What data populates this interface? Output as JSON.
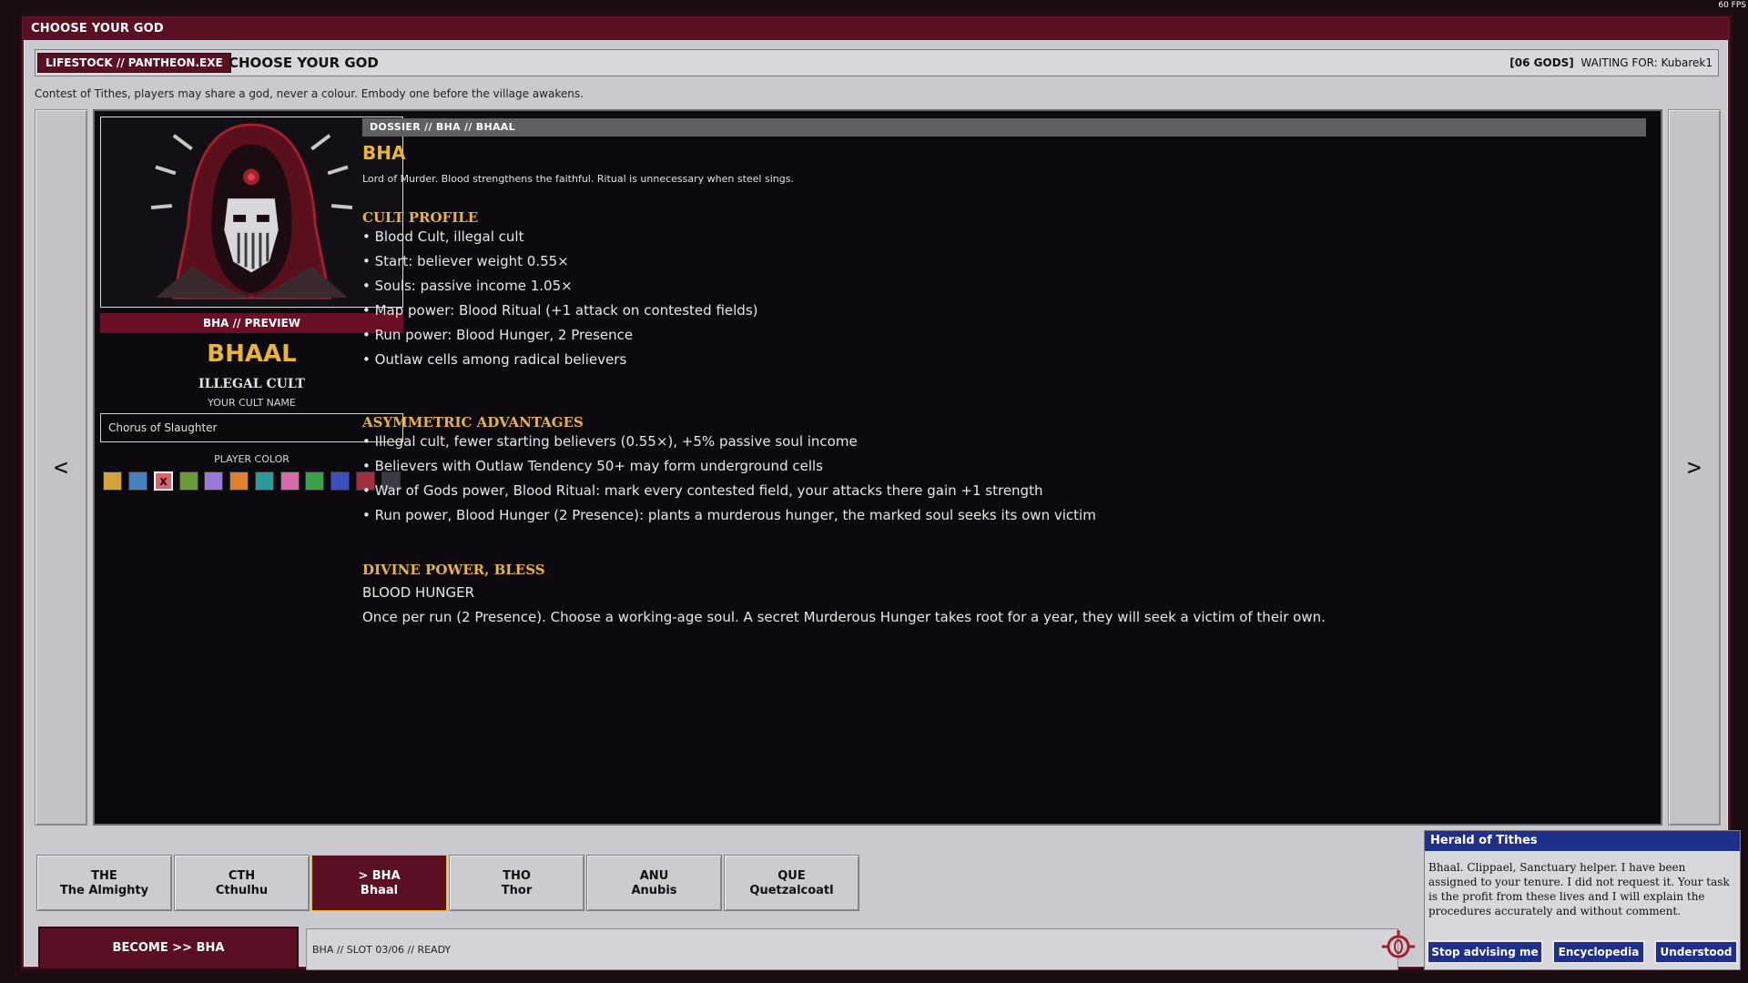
{
  "window": {
    "title": "CHOOSE YOUR GOD",
    "fps": "60 FPS"
  },
  "header": {
    "exe_tag": "LIFESTOCK // PANTHEON.EXE",
    "title": "CHOOSE YOUR GOD",
    "gods_count": "[06 GODS]",
    "waiting": "WAITING FOR: Kubarek1"
  },
  "subtitle": "Contest of Tithes, players may share a god, never a colour. Embody one before the village awakens.",
  "nav": {
    "prev": "<",
    "next": ">"
  },
  "selected": {
    "preview_tag": "BHA // PREVIEW",
    "name": "BHAAL",
    "cult_type": "ILLEGAL CULT",
    "cult_name_label": "YOUR CULT NAME",
    "cult_name_value": "Chorus of Slaughter",
    "player_color_label": "PLAYER COLOR",
    "swatches": [
      {
        "color": "#d4a23a",
        "mark": ""
      },
      {
        "color": "#4a7fc0",
        "mark": ""
      },
      {
        "color": "#e0606a",
        "mark": "X"
      },
      {
        "color": "#6a9a3a",
        "mark": ""
      },
      {
        "color": "#9a7ad8",
        "mark": ""
      },
      {
        "color": "#e0802a",
        "mark": ""
      },
      {
        "color": "#2a9a9a",
        "mark": ""
      },
      {
        "color": "#d86aa8",
        "mark": ""
      },
      {
        "color": "#3aa04a",
        "mark": ""
      },
      {
        "color": "#3a50c0",
        "mark": ""
      },
      {
        "color": "#a03040",
        "mark": ""
      },
      {
        "color": "#3a3a44",
        "mark": ""
      }
    ]
  },
  "dossier": {
    "tag": "DOSSIER // BHA // BHAAL",
    "title": "BHA",
    "lore": "Lord of Murder. Blood strengthens the faithful. Ritual is unnecessary when steel sings.",
    "cult_profile": {
      "heading": "CULT PROFILE",
      "items": [
        "• Blood Cult, illegal cult",
        "• Start: believer weight 0.55×",
        "• Souls: passive income 1.05×",
        "• Map power: Blood Ritual (+1 attack on contested fields)",
        "• Run power: Blood Hunger, 2 Presence",
        "• Outlaw cells among radical believers"
      ]
    },
    "advantages": {
      "heading": "ASYMMETRIC ADVANTAGES",
      "items": [
        "• Illegal cult, fewer starting believers (0.55×), +5% passive soul income",
        "• Believers with Outlaw Tendency 50+ may form underground cells",
        "• War of Gods power, Blood Ritual: mark every contested field, your attacks there gain +1 strength",
        "• Run power, Blood Hunger (2 Presence): plants a murderous hunger, the marked soul seeks its own victim"
      ]
    },
    "divine_power": {
      "heading": "DIVINE POWER, BLESS",
      "name": "BLOOD HUNGER",
      "desc": "Once per run (2 Presence). Choose a working-age soul. A secret Murderous Hunger takes root for a year, they will seek a victim of their own."
    }
  },
  "tabs": [
    {
      "code": "THE",
      "name": "The Almighty",
      "active": false
    },
    {
      "code": "CTH",
      "name": "Cthulhu",
      "active": false
    },
    {
      "code": "> BHA",
      "name": "Bhaal",
      "active": true
    },
    {
      "code": "THO",
      "name": "Thor",
      "active": false
    },
    {
      "code": "ANU",
      "name": "Anubis",
      "active": false
    },
    {
      "code": "QUE",
      "name": "Quetzalcoatl",
      "active": false
    }
  ],
  "footer": {
    "become_label": "BECOME  >>  BHA",
    "status": "BHA // SLOT 03/06 // READY"
  },
  "herald": {
    "title": "Herald of Tithes",
    "body": "Bhaal. Clippael, Sanctuary helper. I have been assigned to your tenure. I did not request it. Your task is the profit from these lives and I will explain the procedures accurately and without comment.",
    "btn_stop": "Stop advising me",
    "btn_encyclopedia": "Encyclopedia",
    "btn_understood": "Understood"
  },
  "colors": {
    "accent_gold": "#e8b43a",
    "crimson": "#5a0f22",
    "herald_blue": "#1f2f8a"
  }
}
